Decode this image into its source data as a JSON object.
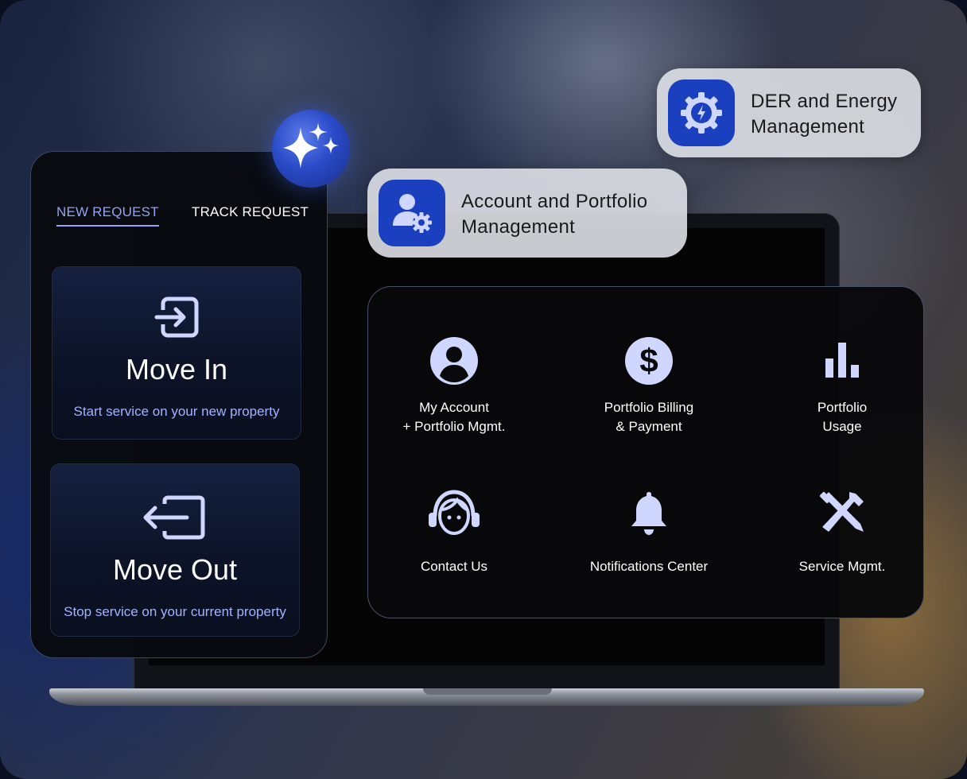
{
  "phone": {
    "tabs": [
      {
        "label": "NEW REQUEST",
        "active": true
      },
      {
        "label": "TRACK REQUEST",
        "active": false
      }
    ],
    "cards": [
      {
        "title": "Move In",
        "subtitle": "Start service on your new property",
        "icon": "move-in-icon"
      },
      {
        "title": "Move Out",
        "subtitle": "Stop service on your current property",
        "icon": "move-out-icon"
      }
    ]
  },
  "pills": {
    "der": {
      "line1": "DER and Energy",
      "line2": "Management",
      "icon": "energy-gear-icon"
    },
    "account": {
      "line1": "Account and Portfolio",
      "line2": "Management",
      "icon": "user-gear-icon"
    }
  },
  "menu": {
    "items": [
      {
        "line1": "My Account",
        "line2": "+ Portfolio Mgmt.",
        "icon": "account-icon"
      },
      {
        "line1": "Portfolio Billing",
        "line2": "& Payment",
        "icon": "dollar-icon"
      },
      {
        "line1": "Portfolio",
        "line2": "Usage",
        "icon": "bar-chart-icon"
      },
      {
        "line1": "Contact Us",
        "icon": "headset-icon"
      },
      {
        "line1": "Notifications Center",
        "icon": "bell-icon"
      },
      {
        "line1": "Service Mgmt.",
        "icon": "tools-icon"
      }
    ]
  },
  "colors": {
    "accent": "#93a4f2",
    "icon_fill": "#cfd6ff",
    "pill_icon_bg": "#1a3fbf",
    "pill_bg": "#dedfe6"
  }
}
